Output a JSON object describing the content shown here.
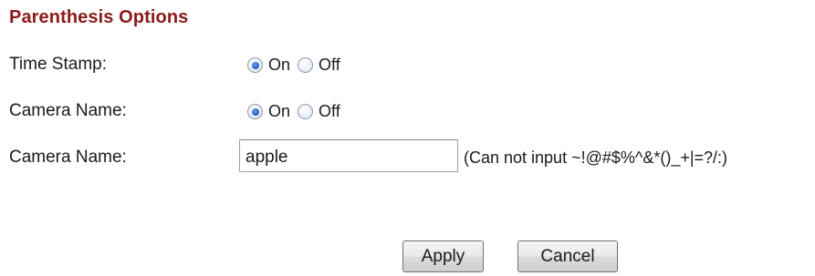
{
  "section": {
    "title": "Parenthesis Options"
  },
  "time_stamp": {
    "label": "Time Stamp:",
    "options": [
      "On",
      "Off"
    ],
    "selected": "On"
  },
  "camera_name_toggle": {
    "label": "Camera Name:",
    "options": [
      "On",
      "Off"
    ],
    "selected": "On"
  },
  "camera_name_input": {
    "label": "Camera Name:",
    "value": "apple",
    "hint": "(Can not input ~!@#$%^&*()_+|=?/:)"
  },
  "buttons": {
    "apply_label": "Apply",
    "cancel_label": "Cancel"
  }
}
